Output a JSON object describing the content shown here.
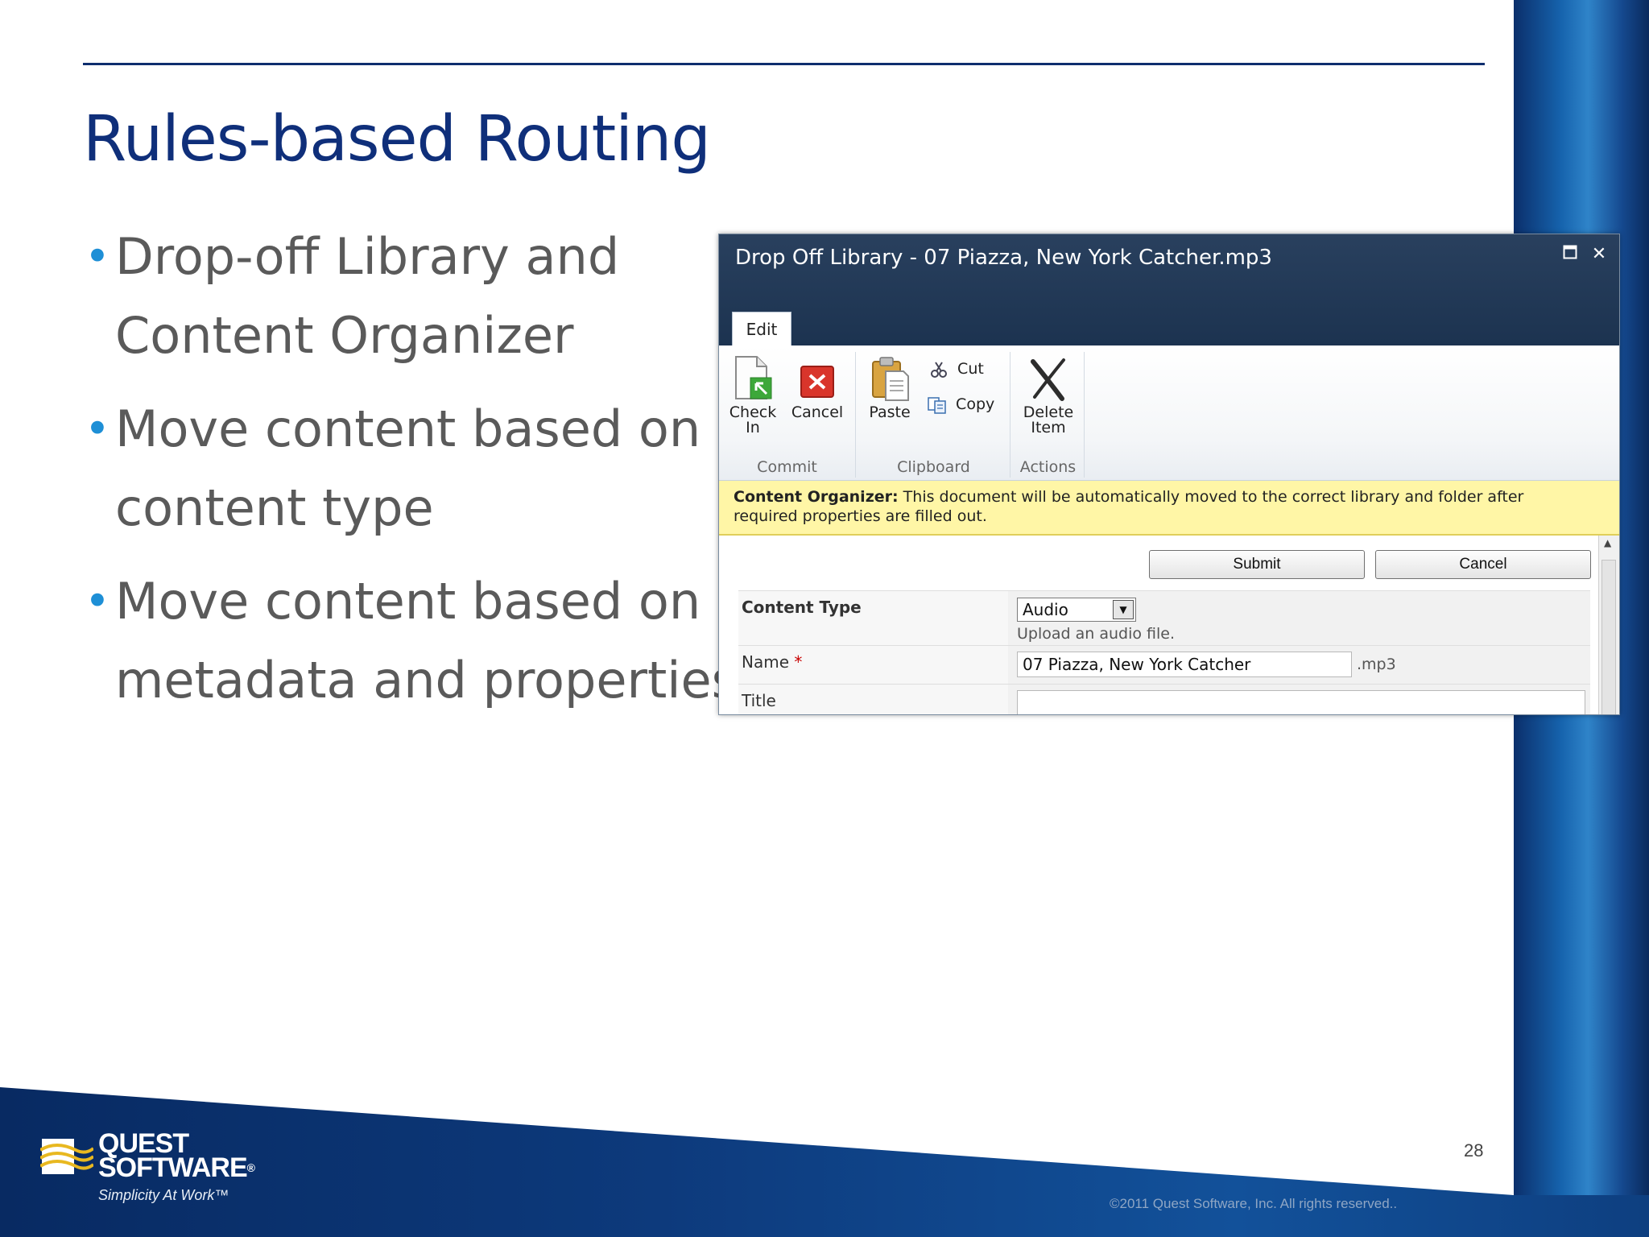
{
  "slide": {
    "title": "Rules-based Routing",
    "bullets": [
      {
        "lines": [
          "Drop-off Library and",
          "Content Organizer"
        ]
      },
      {
        "lines": [
          "Move content based on",
          "content type"
        ]
      },
      {
        "lines": [
          "Move content based on",
          "metadata and properties"
        ]
      }
    ],
    "page_number": "28",
    "copyright": "©2011 Quest Software, Inc. All rights reserved..",
    "logo": {
      "line1": "QUEST",
      "line2": "SOFTWARE",
      "registered": "®",
      "tagline": "Simplicity At Work™"
    }
  },
  "dialog": {
    "title": "Drop Off Library - 07 Piazza, New York Catcher.mp3",
    "controls": {
      "maximize_icon": "maximize-icon",
      "close_icon": "close-icon"
    },
    "tab": "Edit",
    "ribbon": {
      "groups": {
        "commit": {
          "label": "Commit",
          "check_in": {
            "line1": "Check",
            "line2": "In"
          },
          "cancel": "Cancel"
        },
        "clipboard": {
          "label": "Clipboard",
          "paste": "Paste",
          "cut": "Cut",
          "copy": "Copy"
        },
        "actions": {
          "label": "Actions",
          "delete_item": {
            "line1": "Delete",
            "line2": "Item"
          }
        }
      }
    },
    "notice": {
      "heading": "Content Organizer:",
      "text": " This document will be automatically moved to the correct library and folder after required properties are filled out."
    },
    "buttons": {
      "submit": "Submit",
      "cancel": "Cancel"
    },
    "fields": {
      "content_type": {
        "label": "Content Type",
        "value": "Audio",
        "hint": "Upload an audio file."
      },
      "name": {
        "label": "Name",
        "required_mark": "*",
        "value": "07 Piazza, New York Catcher",
        "extension": ".mp3"
      },
      "title": {
        "label": "Title",
        "value": ""
      }
    }
  },
  "colors": {
    "title_blue": "#0f2f7a",
    "bullet_dot": "#1e8fd6",
    "dialog_header": "#1c3350",
    "notice_yellow": "#fff6a6"
  }
}
